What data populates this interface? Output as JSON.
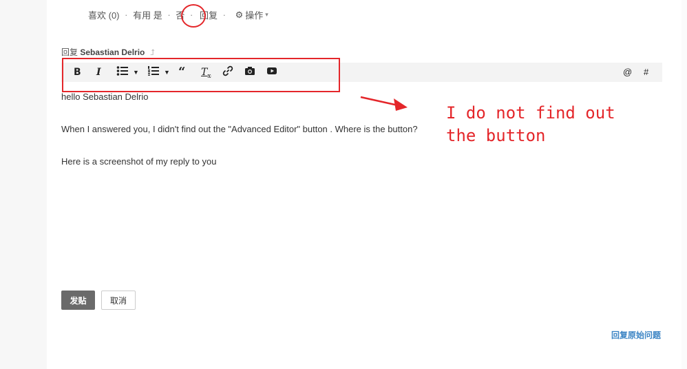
{
  "actions": {
    "like": "喜欢 (0)",
    "dot": "·",
    "useful": "有用",
    "yes": "是",
    "no": "否",
    "reply": "回复",
    "operate": "操作"
  },
  "reply_heading": {
    "prefix": "回复",
    "name": "Sebastian Delrio"
  },
  "toolbar": {
    "bold": "B",
    "italic": "I",
    "quote": "“",
    "clear": "T",
    "at": "@",
    "hash": "#"
  },
  "editor": {
    "line1": "hello Sebastian Delrio",
    "line2": "When I answered you, I didn't find out the \"Advanced Editor\" button . Where is the button?",
    "line3": "Here is a screenshot of my reply to you"
  },
  "annotation": {
    "note": "I do not find out the button"
  },
  "buttons": {
    "submit": "发贴",
    "cancel": "取消"
  },
  "footer": {
    "reply_original": "回复原始问题"
  },
  "colors": {
    "annotation_red": "#e4262a",
    "link_blue": "#3b84c4",
    "submit_gray": "#6a6a6a"
  }
}
